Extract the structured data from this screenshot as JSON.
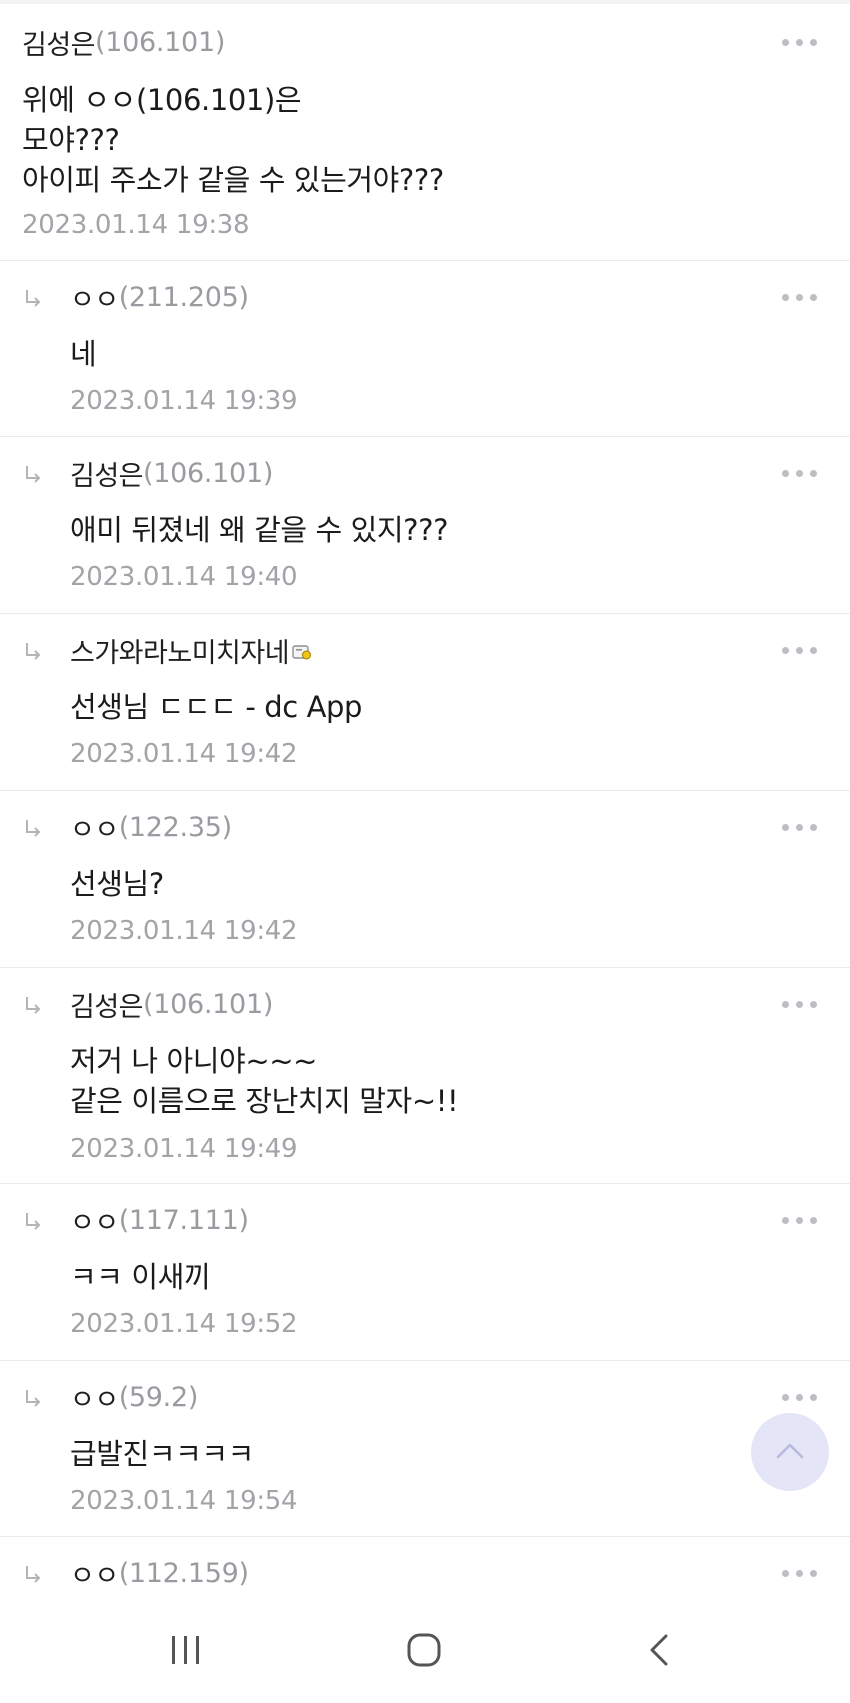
{
  "comments": [
    {
      "author": "김성은",
      "ip": "(106.101)",
      "lines": [
        "위에 ㅇㅇ(106.101)은",
        "모야???",
        "아이피 주소가 같을 수 있는거야???"
      ],
      "time": "2023.01.14 19:38"
    },
    {
      "author": "ㅇㅇ",
      "ip": "(211.205)",
      "lines": [
        "네"
      ],
      "time": "2023.01.14 19:39"
    },
    {
      "author": "김성은",
      "ip": "(106.101)",
      "lines": [
        "애미 뒤졌네 왜 같을 수 있지???"
      ],
      "time": "2023.01.14 19:40"
    },
    {
      "author": "스가와라노미치자네",
      "ip": "",
      "lines": [
        "선생님 ㄷㄷㄷ - dc App"
      ],
      "time": "2023.01.14 19:42"
    },
    {
      "author": "ㅇㅇ",
      "ip": "(122.35)",
      "lines": [
        "선생님?"
      ],
      "time": "2023.01.14 19:42"
    },
    {
      "author": "김성은",
      "ip": "(106.101)",
      "lines": [
        "저거 나 아니야~~~",
        "같은 이름으로 장난치지 말자~!!"
      ],
      "time": "2023.01.14 19:49"
    },
    {
      "author": "ㅇㅇ",
      "ip": "(117.111)",
      "lines": [
        "ㅋㅋ 이새끼"
      ],
      "time": "2023.01.14 19:52"
    },
    {
      "author": "ㅇㅇ",
      "ip": "(59.2)",
      "lines": [
        "급발진ㅋㅋㅋㅋ"
      ],
      "time": "2023.01.14 19:54"
    },
    {
      "author": "ㅇㅇ",
      "ip": "(112.159)",
      "lines": [],
      "time": ""
    }
  ],
  "icons": {
    "reply": "reply-arrow-icon",
    "more": "more-options-icon",
    "member": "fixed-member-icon",
    "scroll_top": "chevron-up-icon",
    "nav_recents": "recent-apps-icon",
    "nav_home": "home-icon",
    "nav_back": "back-icon"
  },
  "colors": {
    "author": "#1f1f22",
    "ip": "#9a9aa0",
    "time": "#a3a3a8",
    "divider": "#ebebee",
    "scroll_button": "#e4e5f7"
  }
}
